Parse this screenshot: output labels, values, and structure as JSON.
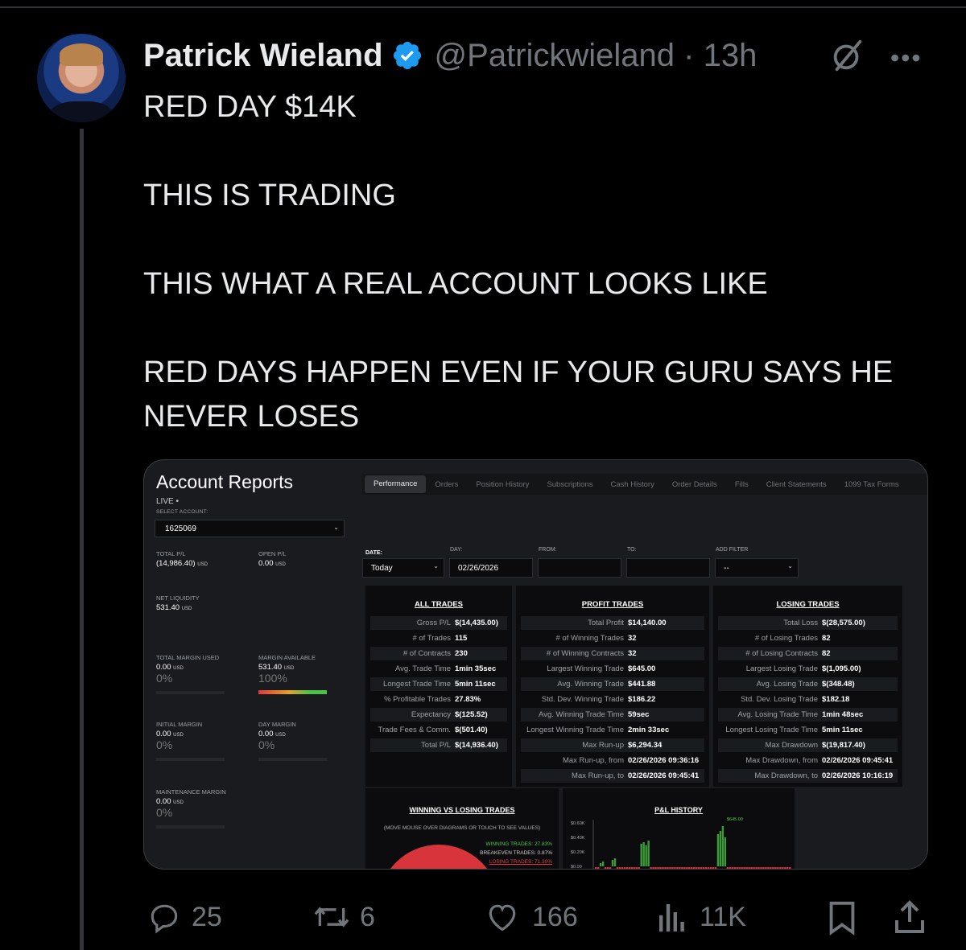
{
  "tweet": {
    "author_name": "Patrick Wieland",
    "handle": "@Patrickwieland",
    "separator": "·",
    "time": "13h",
    "more": "•••",
    "text_lines": [
      "RED DAY $14K",
      "THIS IS TRADING",
      "THIS WHAT A REAL ACCOUNT LOOKS LIKE",
      "RED DAYS HAPPEN EVEN IF YOUR GURU SAYS HE NEVER LOSES"
    ]
  },
  "report": {
    "title": "Account Reports",
    "live": "LIVE •",
    "select_account_label": "SELECT ACCOUNT:",
    "account": "1625069",
    "tabs": [
      "Performance",
      "Orders",
      "Position History",
      "Subscriptions",
      "Cash History",
      "Order Details",
      "Fills",
      "Client Statements",
      "1099 Tax Forms"
    ],
    "active_tab": "Performance",
    "metrics": {
      "total_pl_label": "TOTAL P/L",
      "total_pl": "(14,986.40)",
      "open_pl_label": "OPEN P/L",
      "open_pl": "0.00",
      "net_liquidity_label": "NET LIQUIDITY",
      "net_liquidity": "531.40",
      "total_margin_used_label": "TOTAL MARGIN USED",
      "total_margin_used": "0.00",
      "total_margin_used_pct": "0%",
      "margin_available_label": "MARGIN AVAILABLE",
      "margin_available": "531.40",
      "margin_available_pct": "100%",
      "margin_available_level": 1.0,
      "initial_margin_label": "INITIAL MARGIN",
      "initial_margin": "0.00",
      "initial_margin_pct": "0%",
      "day_margin_label": "DAY MARGIN",
      "day_margin": "0.00",
      "day_margin_pct": "0%",
      "maintenance_margin_label": "MAINTENANCE MARGIN",
      "maintenance_margin": "0.00",
      "maintenance_margin_pct": "0%",
      "currency": "USD"
    },
    "filters": {
      "date_label": "DATE:",
      "date_value": "Today",
      "day_label": "DAY:",
      "day_value": "02/26/2026",
      "from_label": "FROM:",
      "to_label": "TO:",
      "add_filter_label": "ADD FILTER",
      "add_filter_value": "--"
    },
    "all_trades": {
      "title": "ALL TRADES",
      "rows": [
        {
          "k": "Gross P/L",
          "v": "$(14,435.00)"
        },
        {
          "k": "# of Trades",
          "v": "115"
        },
        {
          "k": "# of Contracts",
          "v": "230"
        },
        {
          "k": "Avg. Trade Time",
          "v": "1min 35sec"
        },
        {
          "k": "Longest Trade Time",
          "v": "5min 11sec"
        },
        {
          "k": "% Profitable Trades",
          "v": "27.83%"
        },
        {
          "k": "Expectancy",
          "v": "$(125.52)"
        },
        {
          "k": "Trade Fees & Comm.",
          "v": "$(501.40)"
        },
        {
          "k": "Total P/L",
          "v": "$(14,936.40)"
        }
      ]
    },
    "profit_trades": {
      "title": "PROFIT TRADES",
      "rows": [
        {
          "k": "Total Profit",
          "v": "$14,140.00"
        },
        {
          "k": "# of Winning Trades",
          "v": "32"
        },
        {
          "k": "# of Winning Contracts",
          "v": "32"
        },
        {
          "k": "Largest Winning Trade",
          "v": "$645.00"
        },
        {
          "k": "Avg. Winning Trade",
          "v": "$441.88"
        },
        {
          "k": "Std. Dev. Winning Trade",
          "v": "$186.22"
        },
        {
          "k": "Avg. Winning Trade Time",
          "v": "59sec"
        },
        {
          "k": "Longest Winning Trade Time",
          "v": "2min 33sec"
        },
        {
          "k": "Max Run-up",
          "v": "$6,294.34"
        },
        {
          "k": "Max Run-up, from",
          "v": "02/26/2026 09:36:16"
        },
        {
          "k": "Max Run-up, to",
          "v": "02/26/2026 09:45:41"
        }
      ]
    },
    "losing_trades": {
      "title": "LOSING TRADES",
      "rows": [
        {
          "k": "Total Loss",
          "v": "$(28,575.00)"
        },
        {
          "k": "# of Losing Trades",
          "v": "82"
        },
        {
          "k": "# of Losing Contracts",
          "v": "82"
        },
        {
          "k": "Largest Losing Trade",
          "v": "$(1,095.00)"
        },
        {
          "k": "Avg. Losing Trade",
          "v": "$(348.48)"
        },
        {
          "k": "Std. Dev. Losing Trade",
          "v": "$182.18"
        },
        {
          "k": "Avg. Losing Trade Time",
          "v": "1min 48sec"
        },
        {
          "k": "Longest Losing Trade Time",
          "v": "5min 11sec"
        },
        {
          "k": "Max Drawdown",
          "v": "$(19,817.40)"
        },
        {
          "k": "Max Drawdown, from",
          "v": "02/26/2026 09:45:41"
        },
        {
          "k": "Max Drawdown, to",
          "v": "02/26/2026 10:16:19"
        }
      ]
    },
    "winning_vs_losing": {
      "title": "WINNING VS LOSING TRADES",
      "subtitle": "(MOVE MOUSE OVER DIAGRAMS OR TOUCH TO SEE VALUES)",
      "winning": "WINNING TRADES: 27.83%",
      "breakeven": "BREAKEVEN TRADES: 0.87%",
      "losing": "LOSING TRADES: 71.30%"
    },
    "pl_history": {
      "title": "P&L HISTORY",
      "peak_label": "$645.00",
      "y_ticks": [
        "$0.60K",
        "$0.40K",
        "$0.20K",
        "$0.00"
      ]
    }
  },
  "chart_data": [
    {
      "type": "pie",
      "title": "WINNING VS LOSING TRADES",
      "categories": [
        "WINNING TRADES",
        "BREAKEVEN TRADES",
        "LOSING TRADES"
      ],
      "values": [
        27.83,
        0.87,
        71.3
      ]
    },
    {
      "type": "bar",
      "title": "P&L HISTORY",
      "y_ticks": [
        "$0.60K",
        "$0.40K",
        "$0.20K",
        "$0.00"
      ],
      "annotation": "$645.00",
      "ylim": [
        -0.1,
        0.7
      ]
    }
  ],
  "actions": {
    "replies": "25",
    "reposts": "6",
    "likes": "166",
    "views": "11K"
  },
  "colors": {
    "background": "#000000",
    "verified_blue": "#1d9bf0",
    "muted": "#71767b",
    "loss_red": "#e0383e",
    "win_green": "#3c9c3a"
  }
}
